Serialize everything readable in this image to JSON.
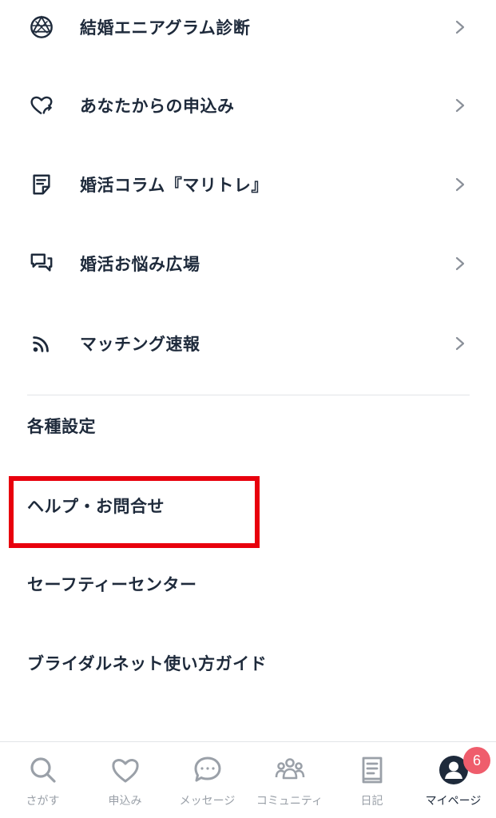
{
  "menu": {
    "items": [
      {
        "label": "結婚エニアグラム診断",
        "icon": "enneagram-icon"
      },
      {
        "label": "あなたからの申込み",
        "icon": "heart-send-icon"
      },
      {
        "label": "婚活コラム『マリトレ』",
        "icon": "column-note-icon"
      },
      {
        "label": "婚活お悩み広場",
        "icon": "chat-bubbles-icon"
      },
      {
        "label": "マッチング速報",
        "icon": "broadcast-icon"
      }
    ]
  },
  "links": {
    "settings": "各種設定",
    "help": "ヘルプ・お問合せ",
    "safety": "セーフティーセンター",
    "guide": "ブライダルネット使い方ガイド"
  },
  "tabbar": {
    "tabs": [
      {
        "label": "さがす",
        "icon": "search-icon"
      },
      {
        "label": "申込み",
        "icon": "heart-icon"
      },
      {
        "label": "メッセージ",
        "icon": "message-icon"
      },
      {
        "label": "コミュニティ",
        "icon": "community-icon"
      },
      {
        "label": "日記",
        "icon": "diary-icon"
      },
      {
        "label": "マイページ",
        "icon": "user-icon"
      }
    ],
    "active_index": 5,
    "badge_count": "6"
  },
  "colors": {
    "text": "#1e2a3b",
    "inactive": "#9aa0a8",
    "highlight": "#e8000d",
    "badge": "#ef5d6c"
  }
}
